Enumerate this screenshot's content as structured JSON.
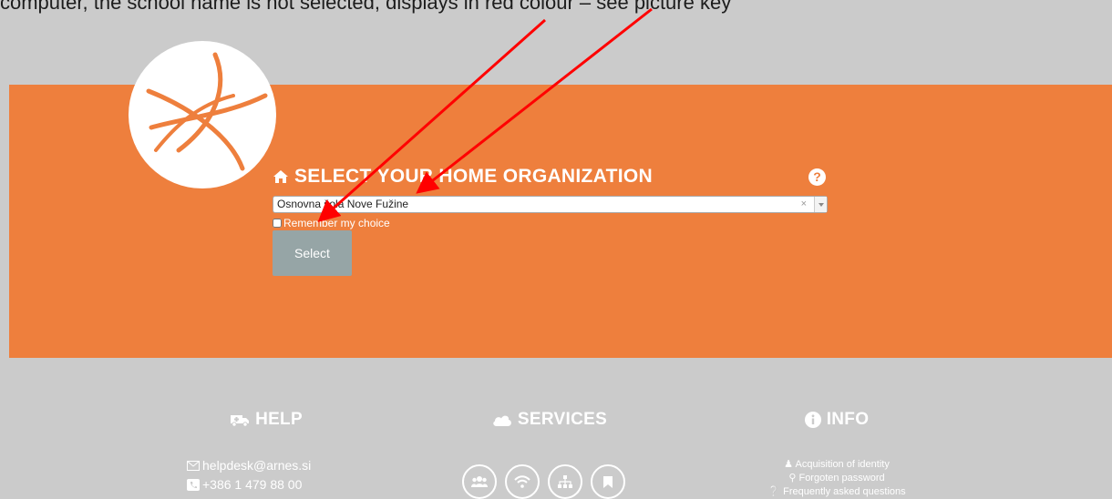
{
  "caption": "computer, the school name is not selected, displays in red colour – see picture key",
  "login": {
    "heading": "SELECT YOUR HOME ORGANIZATION",
    "help_symbol": "?",
    "organization_value": "Osnovna šola Nove Fužine",
    "clear_symbol": "×",
    "remember_label": "Remember my choice",
    "select_label": "Select"
  },
  "footer": {
    "help": {
      "title": "HELP",
      "email": "helpdesk@arnes.si",
      "phone": "+386 1 479 88 00"
    },
    "services": {
      "title": "SERVICES",
      "icons": [
        "users-icon",
        "wifi-icon",
        "sitemap-icon",
        "bookmark-icon"
      ]
    },
    "info": {
      "title": "INFO",
      "links": [
        "Acquisition of identity",
        "Forgoten password",
        "Frequently asked questions"
      ]
    }
  },
  "colors": {
    "band": "#ee7f3d",
    "background": "#cbcbcb",
    "button": "#96a5a6",
    "annotation_arrow": "#ff0000"
  }
}
